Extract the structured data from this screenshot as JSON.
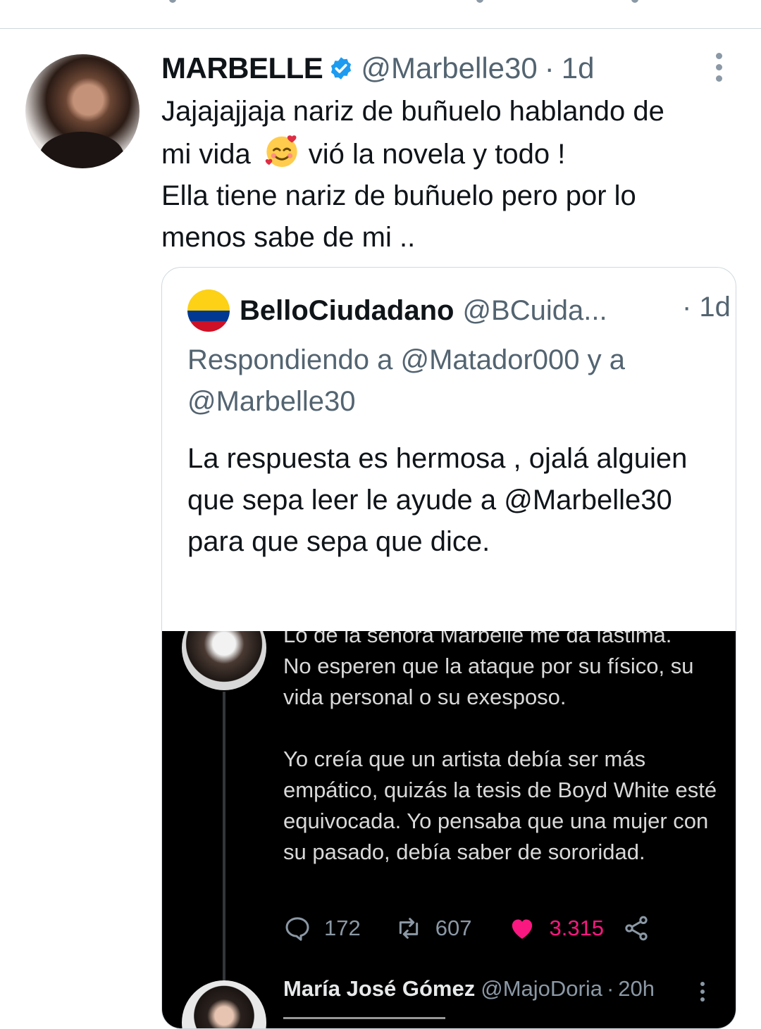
{
  "tweet": {
    "display_name": "MARBELLE",
    "handle": "@Marbelle30",
    "separator": "·",
    "age": "1d",
    "text_lines": [
      "Jajajajjaja nariz de buñuelo hablando de",
      "mi vida",
      "vió la novela y todo !",
      "Ella tiene nariz de buñuelo pero por lo",
      "menos sabe de mi .."
    ],
    "emoji": "smiling-face-with-hearts-emoji"
  },
  "quote": {
    "display_name": "BelloCiudadano",
    "handle": "@BCuida...",
    "age": "· 1d",
    "reply_to": "Respondiendo a @Matador000 y a @Marbelle30",
    "text": "La respuesta es hermosa , ojalá alguien que sepa leer le ayude a @Marbelle30  para que sepa que dice.",
    "flag_colors": [
      "#fcd116",
      "#003893",
      "#ce1126"
    ],
    "screenshot": {
      "cut_line": "Lo de la señora Marbelle me da lástima.",
      "paragraphs": [
        "No esperen que la ataque por su físico, su vida personal o su exesposo.",
        "Yo creía que un artista debía ser más empático, quizás la tesis de Boyd White esté equivocada. Yo pensaba que una mujer con su pasado, debía saber de sororidad."
      ],
      "replies": "172",
      "retweets": "607",
      "likes": "3.315",
      "like_color": "#f91880",
      "next": {
        "display_name": "María José Gómez",
        "handle": "@MajoDoria",
        "separator": "·",
        "age": "20h"
      }
    }
  },
  "colors": {
    "verified": "#1d9bf0",
    "secondary_text": "#536471",
    "border": "#cfd9de"
  }
}
